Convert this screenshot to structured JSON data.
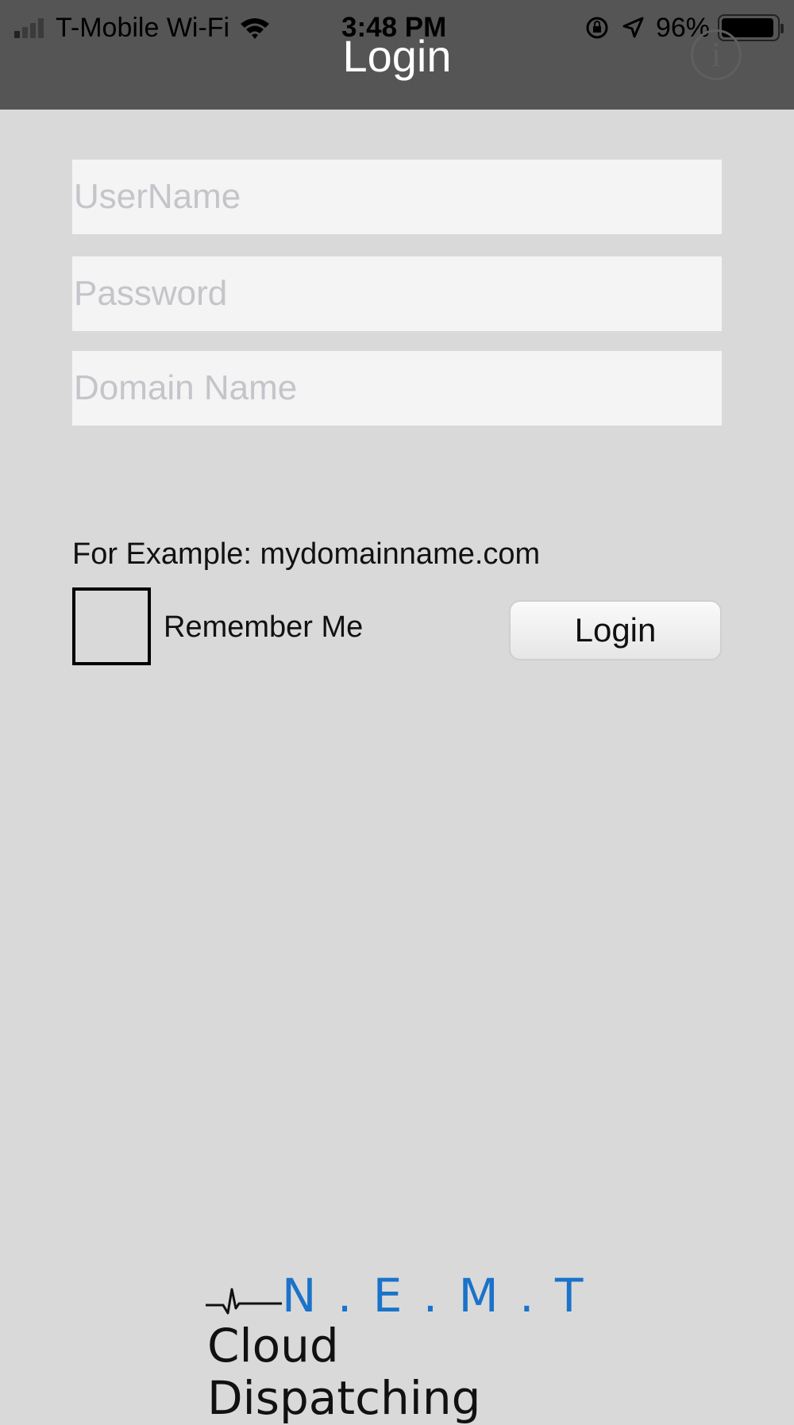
{
  "status_bar": {
    "carrier": "T-Mobile Wi-Fi",
    "time": "3:48 PM",
    "battery_percent": "96%",
    "battery_level": 0.96
  },
  "header": {
    "title": "Login",
    "info_icon": "info-icon"
  },
  "form": {
    "username_placeholder": "UserName",
    "username_value": "",
    "password_placeholder": "Password",
    "password_value": "",
    "domain_placeholder": "Domain Name",
    "domain_value": "",
    "example_text": "For Example: mydomainname.com",
    "remember_label": "Remember Me",
    "remember_checked": false,
    "login_button": "Login"
  },
  "logo": {
    "acronym": "N . E . M . T",
    "subtitle": "Cloud Dispatching"
  },
  "colors": {
    "header_bg": "#555555",
    "page_bg": "#d9d9d9",
    "logo_accent": "#1a73c9"
  }
}
